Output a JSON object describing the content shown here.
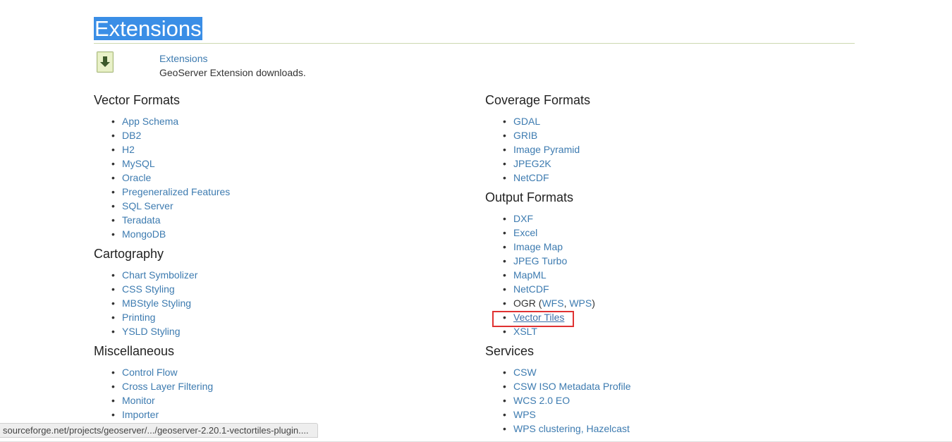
{
  "page": {
    "title": "Extensions",
    "intro_link": "Extensions",
    "intro_desc": "GeoServer Extension downloads."
  },
  "left_sections": [
    {
      "title": "Vector Formats",
      "items": [
        {
          "label": "App Schema"
        },
        {
          "label": "DB2"
        },
        {
          "label": "H2"
        },
        {
          "label": "MySQL"
        },
        {
          "label": "Oracle"
        },
        {
          "label": "Pregeneralized Features"
        },
        {
          "label": "SQL Server"
        },
        {
          "label": "Teradata"
        },
        {
          "label": "MongoDB"
        }
      ]
    },
    {
      "title": "Cartography",
      "items": [
        {
          "label": "Chart Symbolizer"
        },
        {
          "label": "CSS Styling"
        },
        {
          "label": "MBStyle Styling"
        },
        {
          "label": "Printing"
        },
        {
          "label": "YSLD Styling"
        }
      ]
    },
    {
      "title": "Miscellaneous",
      "items": [
        {
          "label": "Control Flow"
        },
        {
          "label": "Cross Layer Filtering"
        },
        {
          "label": "Monitor"
        },
        {
          "label": "Importer"
        }
      ]
    }
  ],
  "right_sections": [
    {
      "title": "Coverage Formats",
      "items": [
        {
          "label": "GDAL"
        },
        {
          "label": "GRIB"
        },
        {
          "label": "Image Pyramid"
        },
        {
          "label": "JPEG2K"
        },
        {
          "label": "NetCDF"
        }
      ]
    },
    {
      "title": "Output Formats",
      "items": [
        {
          "label": "DXF"
        },
        {
          "label": "Excel"
        },
        {
          "label": "Image Map"
        },
        {
          "label": "JPEG Turbo"
        },
        {
          "label": "MapML"
        },
        {
          "label": "NetCDF"
        },
        {
          "prefix": "OGR (",
          "links": [
            "WFS",
            "WPS"
          ],
          "separator": ", ",
          "suffix": ")"
        },
        {
          "label": "Vector Tiles",
          "hovered": true
        },
        {
          "label": "XSLT"
        }
      ]
    },
    {
      "title": "Services",
      "items": [
        {
          "label": "CSW"
        },
        {
          "label": "CSW ISO Metadata Profile"
        },
        {
          "label": "WCS 2.0 EO"
        },
        {
          "label": "WPS"
        },
        {
          "label": "WPS clustering, Hazelcast"
        }
      ]
    }
  ],
  "status_bar": {
    "url": "sourceforge.net/projects/geoserver/.../geoserver-2.20.1-vectortiles-plugin...."
  },
  "colors": {
    "link": "#3d7bb0",
    "title_highlight": "#3a8ee6",
    "annotation_box": "#e03232"
  },
  "icons": {
    "intro": "download-arrow-icon"
  }
}
